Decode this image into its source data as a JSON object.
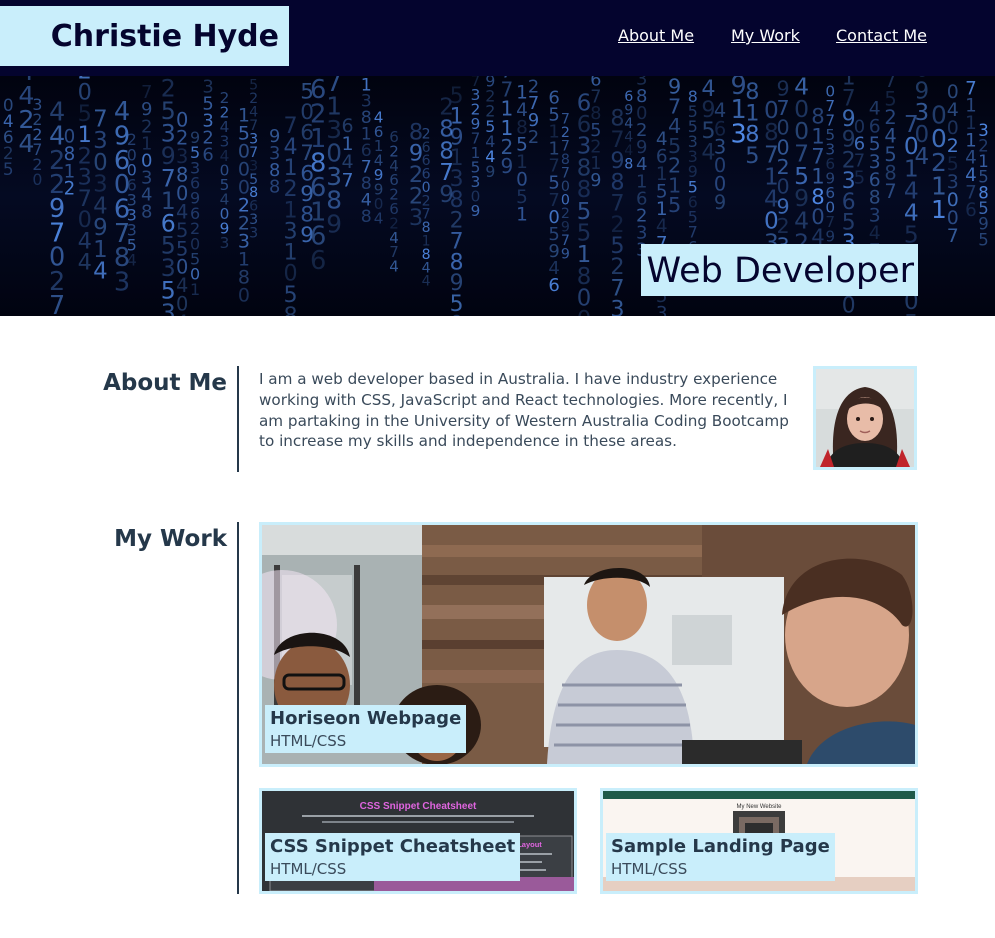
{
  "header": {
    "brand": "Christie Hyde",
    "nav": [
      {
        "label": "About Me"
      },
      {
        "label": "My Work"
      },
      {
        "label": "Contact Me"
      }
    ]
  },
  "hero": {
    "tagline": "Web Developer"
  },
  "about": {
    "title": "About Me",
    "text": "I am a web developer based in Australia. I have industry experience working with CSS, JavaScript and React technologies. More recently, I am partaking in the University of Western Australia Coding Bootcamp to increase my skills and independence in these areas."
  },
  "work": {
    "title": "My Work",
    "projects": [
      {
        "title": "Horiseon Webpage",
        "tech": "HTML/CSS"
      },
      {
        "title": "CSS Snippet Cheatsheet",
        "tech": "HTML/CSS",
        "thumb_title": "CSS Snippet Cheatsheet",
        "thumb_sub": "CSS Grid Layout"
      },
      {
        "title": "Sample Landing Page",
        "tech": "HTML/CSS",
        "thumb_title": "My New Website"
      }
    ]
  },
  "colors": {
    "navy": "#04042e",
    "accent": "#c9eefb",
    "heading": "#25384a"
  }
}
